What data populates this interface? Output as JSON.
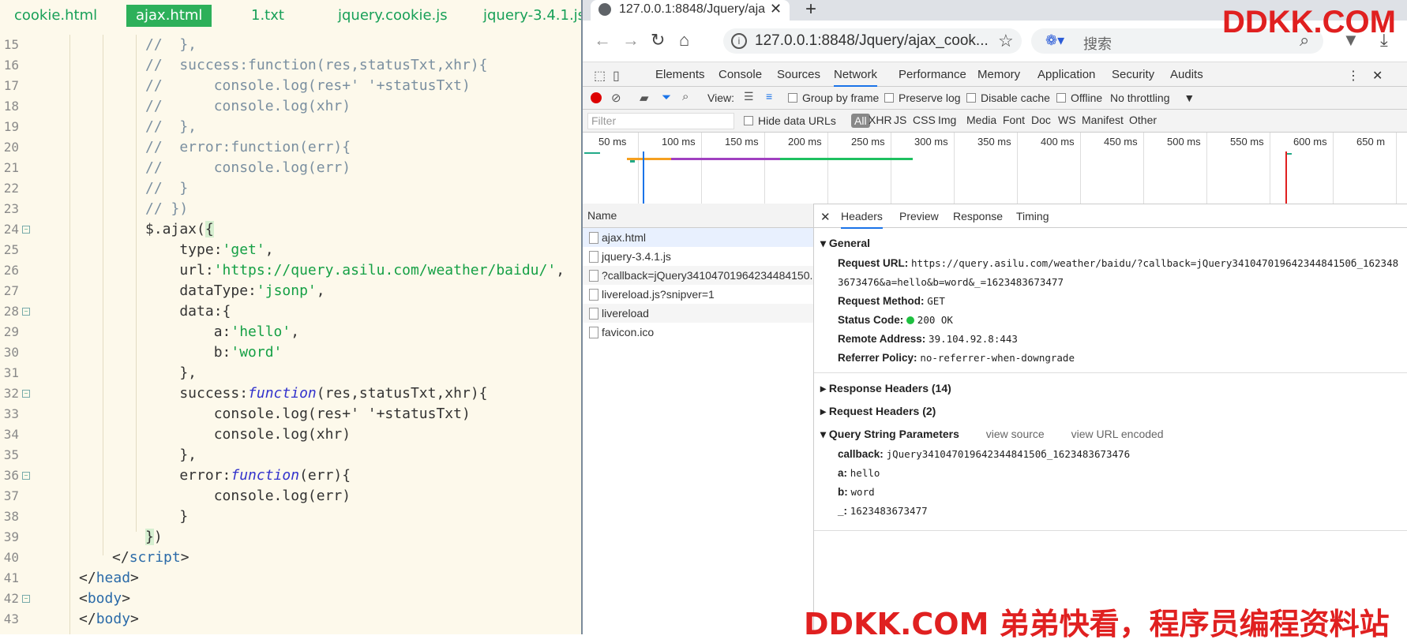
{
  "editor": {
    "tabs": [
      "cookie.html",
      "ajax.html",
      "1.txt",
      "jquery.cookie.js",
      "jquery-3.4.1.js"
    ],
    "lines": [
      {
        "n": "15",
        "code": [
          [
            "c-com",
            "//  },"
          ]
        ]
      },
      {
        "n": "16",
        "code": [
          [
            "c-com",
            "//  success:function(res,statusTxt,xhr){"
          ]
        ]
      },
      {
        "n": "17",
        "code": [
          [
            "c-com",
            "//      console.log(res+' '+statusTxt)"
          ]
        ]
      },
      {
        "n": "18",
        "code": [
          [
            "c-com",
            "//      console.log(xhr)"
          ]
        ]
      },
      {
        "n": "19",
        "code": [
          [
            "c-com",
            "//  },"
          ]
        ]
      },
      {
        "n": "20",
        "code": [
          [
            "c-com",
            "//  error:function(err){"
          ]
        ]
      },
      {
        "n": "21",
        "code": [
          [
            "c-com",
            "//      console.log(err)"
          ]
        ]
      },
      {
        "n": "22",
        "code": [
          [
            "c-com",
            "//  }"
          ]
        ]
      },
      {
        "n": "23",
        "code": [
          [
            "c-com",
            "// })"
          ]
        ]
      },
      {
        "n": "24",
        "fold": true,
        "code": [
          [
            "",
            "$.ajax("
          ],
          [
            "c-br",
            "{"
          ]
        ]
      },
      {
        "n": "25",
        "code": [
          [
            "",
            "    type:"
          ],
          [
            "c-str",
            "'get'"
          ],
          [
            "",
            ","
          ]
        ]
      },
      {
        "n": "26",
        "code": [
          [
            "",
            "    url:"
          ],
          [
            "c-str",
            "'https://query.asilu.com/weather/baidu/'"
          ],
          [
            "",
            ","
          ]
        ]
      },
      {
        "n": "27",
        "code": [
          [
            "",
            "    dataType:"
          ],
          [
            "c-str",
            "'jsonp'"
          ],
          [
            "",
            ","
          ]
        ]
      },
      {
        "n": "28",
        "fold": true,
        "code": [
          [
            "",
            "    data:{"
          ]
        ]
      },
      {
        "n": "29",
        "code": [
          [
            "",
            "        a:"
          ],
          [
            "c-str",
            "'hello'"
          ],
          [
            "",
            ","
          ]
        ]
      },
      {
        "n": "30",
        "code": [
          [
            "",
            "        b:"
          ],
          [
            "c-str",
            "'word'"
          ]
        ]
      },
      {
        "n": "31",
        "code": [
          [
            "",
            "    },"
          ]
        ]
      },
      {
        "n": "32",
        "fold": true,
        "code": [
          [
            "",
            "    success:"
          ],
          [
            "c-kw",
            "function"
          ],
          [
            "",
            "(res,statusTxt,xhr){"
          ]
        ]
      },
      {
        "n": "33",
        "code": [
          [
            "",
            "        console.log(res+' '+statusTxt)"
          ]
        ]
      },
      {
        "n": "34",
        "code": [
          [
            "",
            "        console.log(xhr)"
          ]
        ]
      },
      {
        "n": "35",
        "code": [
          [
            "",
            "    },"
          ]
        ]
      },
      {
        "n": "36",
        "fold": true,
        "code": [
          [
            "",
            "    error:"
          ],
          [
            "c-kw",
            "function"
          ],
          [
            "",
            "(err){"
          ]
        ]
      },
      {
        "n": "37",
        "code": [
          [
            "",
            "        console.log(err)"
          ]
        ]
      },
      {
        "n": "38",
        "code": [
          [
            "",
            "    }"
          ]
        ]
      },
      {
        "n": "39",
        "code": [
          [
            "c-br",
            "}"
          ],
          [
            ")",
            ")"
          ]
        ]
      },
      {
        "n": "40",
        "code": [
          [
            "",
            "</"
          ],
          [
            "c-tag",
            "script"
          ],
          [
            "",
            ">"
          ]
        ]
      },
      {
        "n": "41",
        "code": [
          [
            "",
            "</"
          ],
          [
            "c-tag",
            "head"
          ],
          [
            "",
            ">"
          ]
        ]
      },
      {
        "n": "42",
        "fold": true,
        "code": [
          [
            "",
            "<"
          ],
          [
            "c-tag",
            "body"
          ],
          [
            "",
            ">"
          ]
        ]
      },
      {
        "n": "43",
        "code": [
          [
            "",
            "</"
          ],
          [
            "c-tag",
            "body"
          ],
          [
            "",
            ">"
          ]
        ]
      }
    ]
  },
  "browser": {
    "tab_title": "127.0.0.1:8848/Jquery/ajax_coo",
    "url": "127.0.0.1:8848/Jquery/ajax_cook...",
    "search_placeholder": "搜索",
    "brand": "DDKK.COM"
  },
  "devtools": {
    "tabs": [
      "Elements",
      "Console",
      "Sources",
      "Network",
      "Performance",
      "Memory",
      "Application",
      "Security",
      "Audits"
    ],
    "toolbar": {
      "view": "View:",
      "group_by_frame": "Group by frame",
      "preserve_log": "Preserve log",
      "disable_cache": "Disable cache",
      "offline": "Offline",
      "throttling": "No throttling"
    },
    "filter": {
      "placeholder": "Filter",
      "hide_data_urls": "Hide data URLs",
      "types": [
        "All",
        "XHR",
        "JS",
        "CSS",
        "Img",
        "Media",
        "Font",
        "Doc",
        "WS",
        "Manifest",
        "Other"
      ]
    },
    "timeline_ticks": [
      "50 ms",
      "100 ms",
      "150 ms",
      "200 ms",
      "250 ms",
      "300 ms",
      "350 ms",
      "400 ms",
      "450 ms",
      "500 ms",
      "550 ms",
      "600 ms",
      "650 m"
    ],
    "requests_header": "Name",
    "requests": [
      "ajax.html",
      "jquery-3.4.1.js",
      "?callback=jQuery34104701964234484150...",
      "livereload.js?snipver=1",
      "livereload",
      "favicon.ico"
    ],
    "detail_tabs": [
      "Headers",
      "Preview",
      "Response",
      "Timing"
    ],
    "general": {
      "title": "General",
      "request_url_label": "Request URL:",
      "request_url_1": "https://query.asilu.com/weather/baidu/?callback=jQuery34104701964234484150б_162348",
      "request_url_2": "3673476&a=hello&b=word&_=1623483673477",
      "method_label": "Request Method:",
      "method": "GET",
      "status_label": "Status Code:",
      "status": "200 OK",
      "remote_label": "Remote Address:",
      "remote": "39.104.92.8:443",
      "referrer_label": "Referrer Policy:",
      "referrer": "no-referrer-when-downgrade"
    },
    "response_headers": "Response Headers (14)",
    "request_headers": "Request Headers (2)",
    "query": {
      "title": "Query String Parameters",
      "view_source": "view source",
      "view_url_encoded": "view URL encoded",
      "params": [
        {
          "k": "callback:",
          "v": "jQuery34104701964234484150б_1623483673476"
        },
        {
          "k": "a:",
          "v": "hello"
        },
        {
          "k": "b:",
          "v": "word"
        },
        {
          "k": "_:",
          "v": "1623483673477"
        }
      ]
    }
  },
  "watermark": "DDKK.COM 弟弟快看，程序员编程资料站"
}
